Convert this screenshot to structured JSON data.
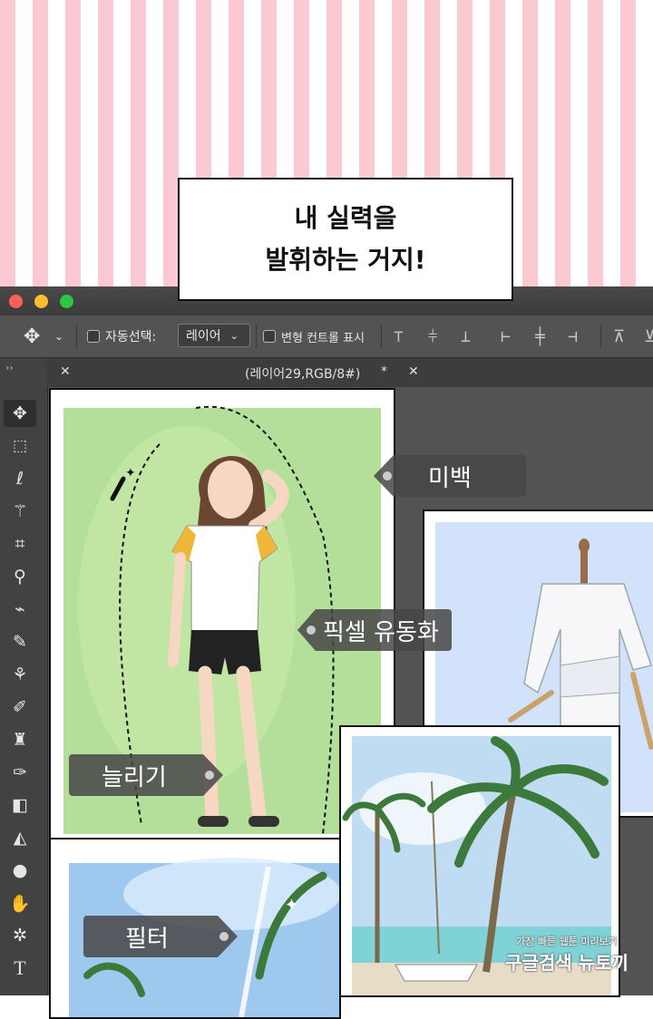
{
  "speech_bubble": {
    "line1": "내 실력을",
    "line2": "발휘하는 거지!"
  },
  "window": {
    "traffic_lights": [
      "#fe5f57",
      "#febc2e",
      "#28c840"
    ]
  },
  "options_bar": {
    "auto_select_label": "자동선택:",
    "auto_select_value": "레이어",
    "transform_label": "변형 컨트롤 표시"
  },
  "document_tab": {
    "title": "(레이어29,RGB/8#)",
    "modified_mark": "*"
  },
  "tools": [
    "move-tool",
    "marquee-tool",
    "lasso-tool",
    "magic-wand-tool",
    "crop-tool",
    "eyedropper-tool",
    "healing-brush-tool",
    "brush-tool",
    "clone-stamp-tool",
    "history-brush-tool",
    "eraser-tool",
    "paint-bucket-tool",
    "blur-tool",
    "dodge-tool",
    "pen-tool",
    "type-tool"
  ],
  "labels": {
    "whitening": "미백",
    "liquify": "픽셀 유동화",
    "stretch": "늘리기",
    "filter": "필터"
  },
  "watermark": {
    "line1": "가장 빠른 웹툰 미리보기",
    "line2": "구글검색 뉴토끼"
  }
}
